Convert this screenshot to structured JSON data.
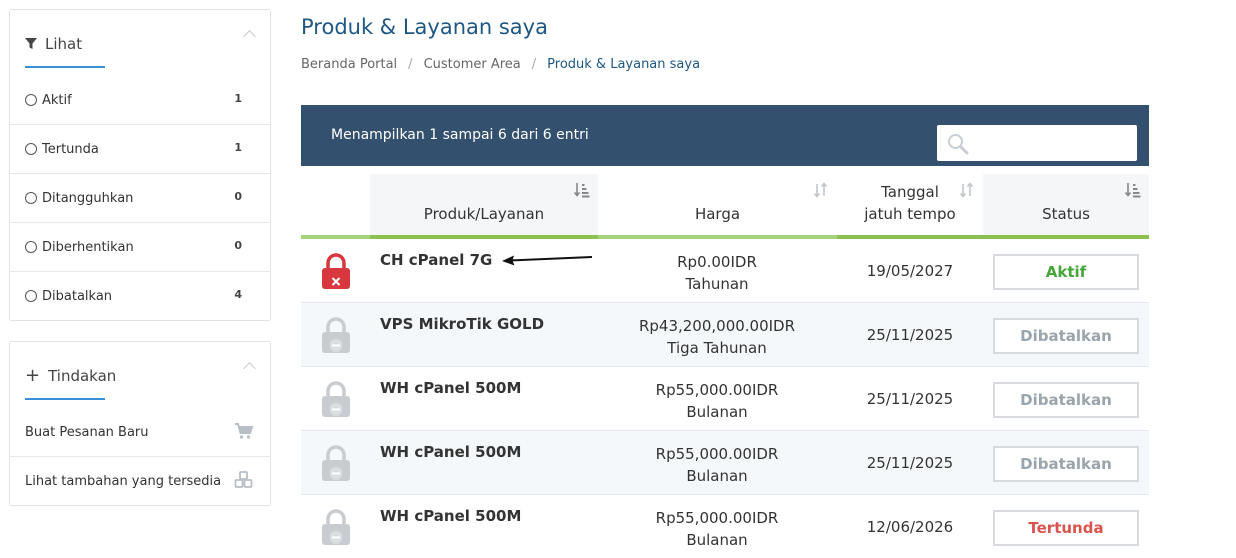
{
  "sidebar": {
    "filter": {
      "title": "Lihat",
      "items": [
        {
          "label": "Aktif",
          "count": "1"
        },
        {
          "label": "Tertunda",
          "count": "1"
        },
        {
          "label": "Ditangguhkan",
          "count": "0"
        },
        {
          "label": "Diberhentikan",
          "count": "0"
        },
        {
          "label": "Dibatalkan",
          "count": "4"
        }
      ]
    },
    "actions": {
      "title": "Tindakan",
      "items": [
        {
          "label": "Buat Pesanan Baru",
          "icon": "cart-icon"
        },
        {
          "label": "Lihat tambahan yang tersedia",
          "icon": "cubes-icon"
        }
      ]
    }
  },
  "page": {
    "title": "Produk & Layanan saya",
    "breadcrumb": [
      "Beranda Portal",
      "Customer Area",
      "Produk & Layanan saya"
    ]
  },
  "table": {
    "info": "Menampilkan 1 sampai 6 dari 6 entri",
    "search_placeholder": "",
    "columns": {
      "product": "Produk/Layanan",
      "price": "Harga",
      "due_line1": "Tanggal",
      "due_line2": "jatuh tempo",
      "status": "Status"
    },
    "rows": [
      {
        "product": "CH cPanel 7G",
        "price": "Rp0.00IDR",
        "cycle": "Tahunan",
        "due": "19/05/2027",
        "status": "Aktif",
        "status_color": "#45a538",
        "lock": "red"
      },
      {
        "product": "VPS MikroTik GOLD",
        "price": "Rp43,200,000.00IDR",
        "cycle": "Tiga Tahunan",
        "due": "25/11/2025",
        "status": "Dibatalkan",
        "status_color": "#9aa4ad",
        "lock": "grey"
      },
      {
        "product": "WH cPanel 500M",
        "price": "Rp55,000.00IDR",
        "cycle": "Bulanan",
        "due": "25/11/2025",
        "status": "Dibatalkan",
        "status_color": "#9aa4ad",
        "lock": "grey"
      },
      {
        "product": "WH cPanel 500M",
        "price": "Rp55,000.00IDR",
        "cycle": "Bulanan",
        "due": "25/11/2025",
        "status": "Dibatalkan",
        "status_color": "#9aa4ad",
        "lock": "grey"
      },
      {
        "product": "WH cPanel 500M",
        "price": "Rp55,000.00IDR",
        "cycle": "Bulanan",
        "due": "12/06/2026",
        "status": "Tertunda",
        "status_color": "#d9534f",
        "lock": "grey"
      }
    ]
  },
  "colors": {
    "header_bar": "#34506f",
    "title": "#1e5783",
    "accent_green": "#8cc152",
    "lock_red": "#d9373e",
    "lock_grey": "#c8ccd0"
  }
}
